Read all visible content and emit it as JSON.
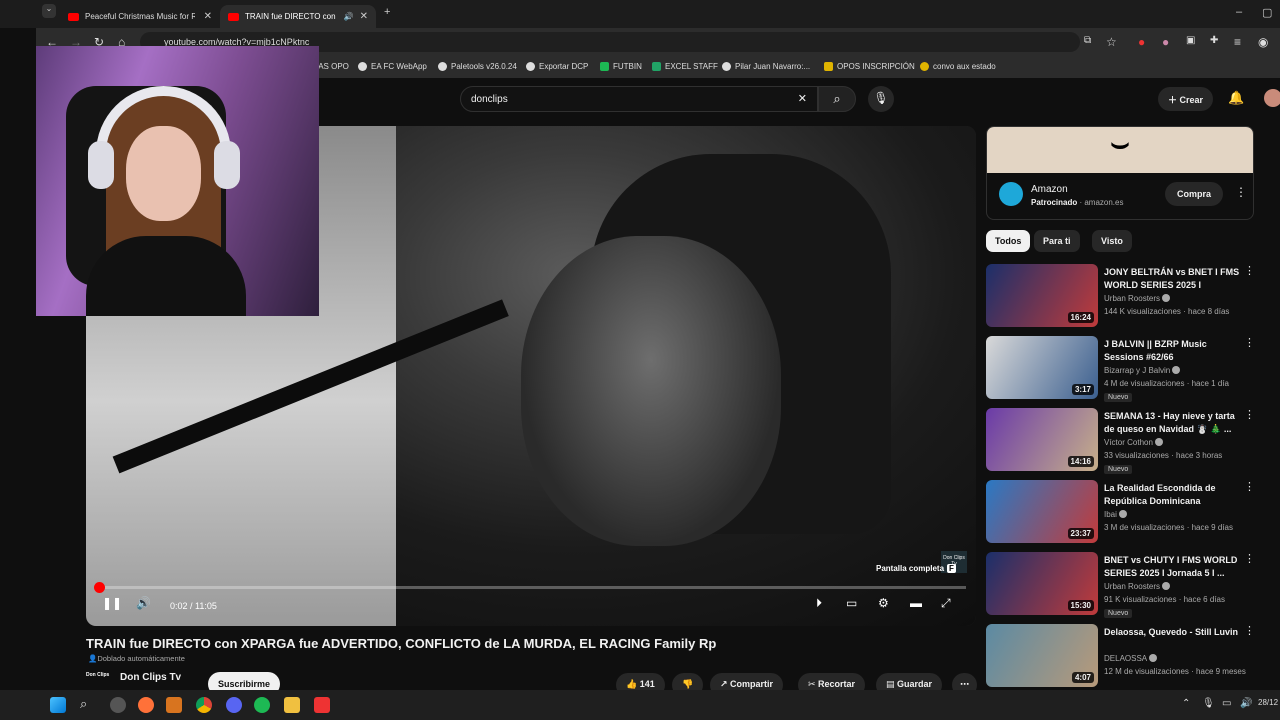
{
  "browser": {
    "tabs": [
      {
        "label": "Peaceful Christmas Music for Re",
        "active": false
      },
      {
        "label": "TRAIN fue DIRECTO con XP",
        "active": true
      }
    ],
    "url": "youtube.com/watch?v=mjb1cNPktnc",
    "bookmarks": [
      "IAS OPO",
      "EA FC WebApp",
      "Paletools v26.0.24",
      "Exportar DCP",
      "FUTBIN",
      "EXCEL STAFF",
      "Pilar Juan Navarro:...",
      "OPOS INSCRIPCIÓN",
      "convo aux estado"
    ]
  },
  "header": {
    "search_value": "donclips",
    "create_label": "Crear"
  },
  "player": {
    "time_current": "0:02",
    "time_total": "11:05",
    "progress_fraction": 0.003,
    "tooltip": "Pantalla completa",
    "tooltip_key": "F",
    "watermark": "Don Clips Tv"
  },
  "video": {
    "title": "TRAIN fue DIRECTO con XPARGA fue ADVERTIDO, CONFLICTO de LA MURDA, EL RACING Family Rp",
    "dubbing": "Doblado automáticamente",
    "channel": "Don Clips Tv",
    "channel_avatar_text": "Don Clips",
    "subscribe_label": "Suscribirme",
    "likes": "141",
    "share_label": "Compartir",
    "clip_label": "Recortar",
    "save_label": "Guardar"
  },
  "ad": {
    "name": "Amazon",
    "sponsored": "Patrocinado",
    "domain": "amazon.es",
    "cta": "Compra"
  },
  "chips": [
    "Todos",
    "Para ti",
    "Visto"
  ],
  "recommendations": [
    {
      "title": "JONY BELTRÁN vs BNET I FMS WORLD SERIES 2025 I Jornad...",
      "channel": "Urban Roosters",
      "views": "144 K visualizaciones",
      "age": "hace 8 días",
      "duration": "16:24",
      "badge": "",
      "color1": "#1b2f6a",
      "color2": "#c03b3b"
    },
    {
      "title": "J BALVIN || BZRP Music Sessions #62/66",
      "channel": "Bizarrap y J Balvin",
      "views": "4 M de visualizaciones",
      "age": "hace 1 día",
      "duration": "3:17",
      "badge": "Nuevo",
      "color1": "#d9d9d9",
      "color2": "#3b5f8f"
    },
    {
      "title": "SEMANA 13 - Hay nieve y tarta de queso en Navidad ☃️ 🎄 ...",
      "channel": "Víctor Cothon",
      "views": "33 visualizaciones",
      "age": "hace 3 horas",
      "duration": "14:16",
      "badge": "Nuevo",
      "color1": "#6a3aa8",
      "color2": "#c7b08a"
    },
    {
      "title": "La Realidad Escondida de República Dominicana",
      "channel": "Ibai",
      "views": "3 M de visualizaciones",
      "age": "hace 9 días",
      "duration": "23:37",
      "badge": "",
      "color1": "#2a79c4",
      "color2": "#c23b3b"
    },
    {
      "title": "BNET vs CHUTY I FMS WORLD SERIES 2025 I Jornada 5 I ...",
      "channel": "Urban Roosters",
      "views": "91 K visualizaciones",
      "age": "hace 6 días",
      "duration": "15:30",
      "badge": "Nuevo",
      "color1": "#1b2f6a",
      "color2": "#c03b3b"
    },
    {
      "title": "Delaossa, Quevedo - Still Luvin",
      "channel": "DELAOSSA",
      "views": "12 M de visualizaciones",
      "age": "hace 9 meses",
      "duration": "4:07",
      "badge": "",
      "color1": "#5b8aa3",
      "color2": "#b89a7a"
    }
  ],
  "taskbar": {
    "date": "28/12"
  }
}
